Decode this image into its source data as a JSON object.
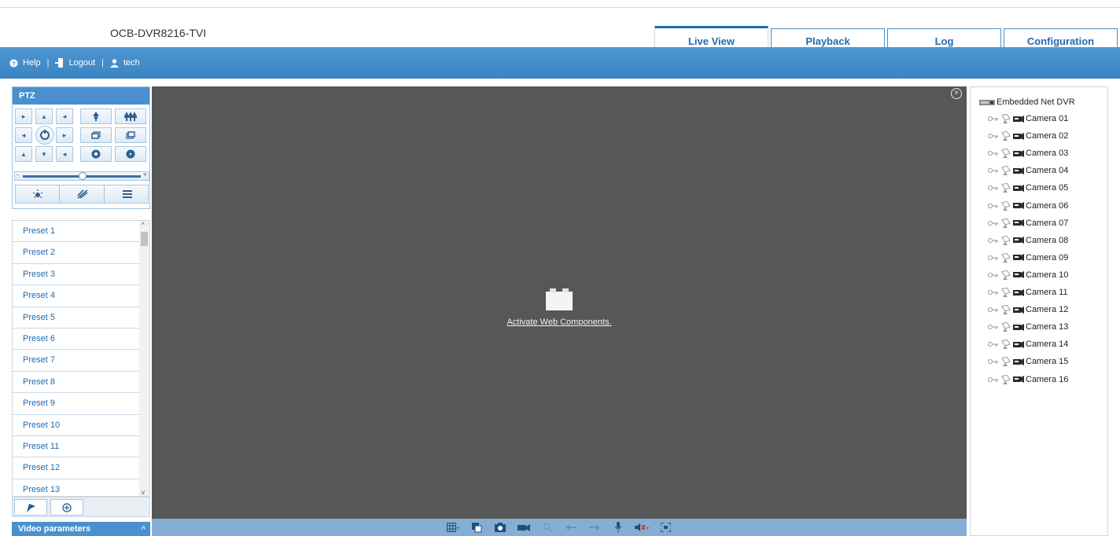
{
  "device_name": "OCB-DVR8216-TVI",
  "tabs": [
    {
      "label": "Live View",
      "active": true
    },
    {
      "label": "Playback",
      "active": false
    },
    {
      "label": "Log",
      "active": false
    },
    {
      "label": "Configuration",
      "active": false
    }
  ],
  "userbar": {
    "help": "Help",
    "logout": "Logout",
    "user": "tech",
    "separator": "|"
  },
  "ptz": {
    "title": "PTZ",
    "zoom_minus": "-",
    "zoom_plus": "+",
    "speed_level": 0.5
  },
  "presets": [
    "Preset 1",
    "Preset 2",
    "Preset 3",
    "Preset 4",
    "Preset 5",
    "Preset 6",
    "Preset 7",
    "Preset 8",
    "Preset 9",
    "Preset 10",
    "Preset 11",
    "Preset 12",
    "Preset 13"
  ],
  "video_parameters": "Video parameters",
  "video": {
    "activate_link": "Activate Web Components."
  },
  "tree": {
    "root": "Embedded Net DVR",
    "cameras": [
      "Camera 01",
      "Camera 02",
      "Camera 03",
      "Camera 04",
      "Camera 05",
      "Camera 06",
      "Camera 07",
      "Camera 08",
      "Camera 09",
      "Camera 10",
      "Camera 11",
      "Camera 12",
      "Camera 13",
      "Camera 14",
      "Camera 15",
      "Camera 16"
    ]
  },
  "colors": {
    "accent": "#1f6bb0",
    "bar": "#4a90cf",
    "video_bg": "#575757"
  }
}
